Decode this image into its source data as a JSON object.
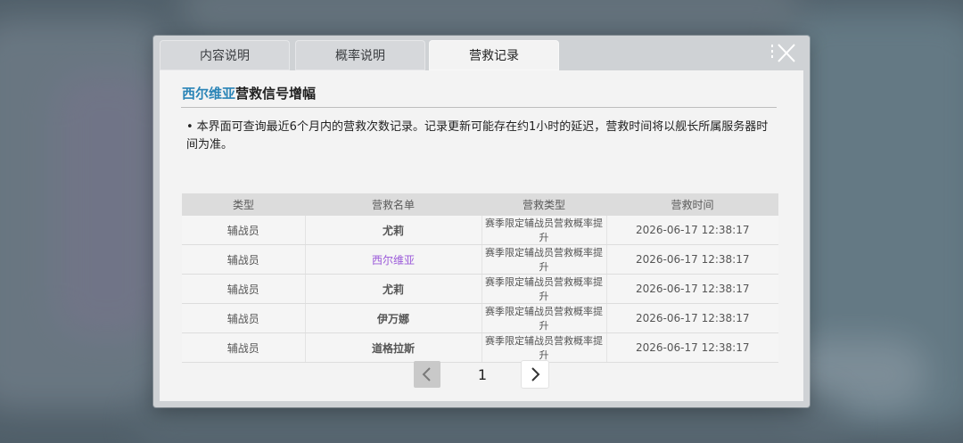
{
  "tabs": [
    {
      "label": "内容说明",
      "active": false
    },
    {
      "label": "概率说明",
      "active": false
    },
    {
      "label": "营救记录",
      "active": true
    }
  ],
  "header": {
    "title_highlight": "西尔维亚",
    "title_rest": "营救信号增幅"
  },
  "note": {
    "bullet": "•",
    "text": "本界面可查询最近6个月内的营救次数记录。记录更新可能存在约1小时的延迟，营救时间将以舰长所属服务器时间为准。"
  },
  "table": {
    "columns": [
      "类型",
      "营救名单",
      "营救类型",
      "营救时间"
    ],
    "rows": [
      {
        "type": "辅战员",
        "name": "尤莉",
        "kind": "赛季限定辅战员营救概率提升",
        "time": "2026-06-17 12:38:17",
        "highlight": false
      },
      {
        "type": "辅战员",
        "name": "西尔维亚",
        "kind": "赛季限定辅战员营救概率提升",
        "time": "2026-06-17 12:38:17",
        "highlight": true
      },
      {
        "type": "辅战员",
        "name": "尤莉",
        "kind": "赛季限定辅战员营救概率提升",
        "time": "2026-06-17 12:38:17",
        "highlight": false
      },
      {
        "type": "辅战员",
        "name": "伊万娜",
        "kind": "赛季限定辅战员营救概率提升",
        "time": "2026-06-17 12:38:17",
        "highlight": false
      },
      {
        "type": "辅战员",
        "name": "道格拉斯",
        "kind": "赛季限定辅战员营救概率提升",
        "time": "2026-06-17 12:38:17",
        "highlight": false
      }
    ]
  },
  "pager": {
    "current_page": "1",
    "prev_icon": "chevron-left-icon",
    "next_icon": "chevron-right-icon"
  },
  "close_icon": "close-icon",
  "colors": {
    "title_highlight": "#2b85b7",
    "name_highlight": "#9b5ad9"
  }
}
